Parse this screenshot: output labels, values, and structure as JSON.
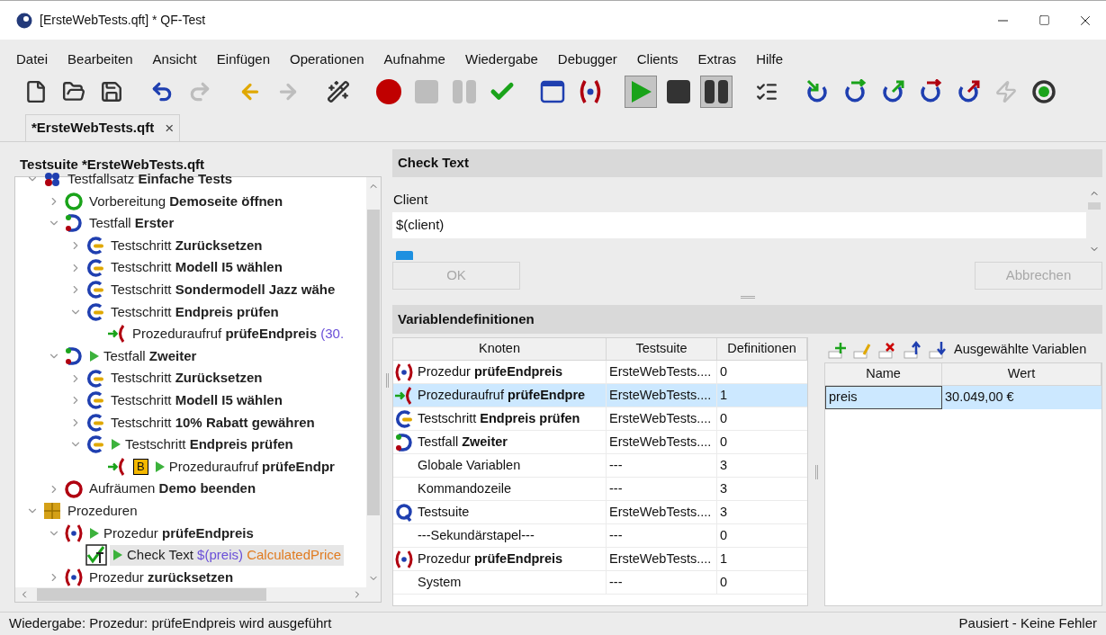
{
  "window": {
    "title": "[ErsteWebTests.qft] * QF-Test"
  },
  "menu": [
    "Datei",
    "Bearbeiten",
    "Ansicht",
    "Einfügen",
    "Operationen",
    "Aufnahme",
    "Wiedergabe",
    "Debugger",
    "Clients",
    "Extras",
    "Hilfe"
  ],
  "toolbar": [
    [
      {
        "kind": "new",
        "disabled": false
      },
      {
        "kind": "open",
        "disabled": false
      },
      {
        "kind": "save",
        "disabled": false
      }
    ],
    [
      {
        "kind": "undo",
        "disabled": false
      },
      {
        "kind": "redo",
        "disabled": true
      }
    ],
    [
      {
        "kind": "back",
        "disabled": false
      },
      {
        "kind": "forward",
        "disabled": true
      }
    ],
    [
      {
        "kind": "wizard",
        "disabled": false
      }
    ],
    [
      {
        "kind": "record",
        "disabled": false
      },
      {
        "kind": "stop",
        "disabled": true
      },
      {
        "kind": "pause",
        "disabled": true
      },
      {
        "kind": "check",
        "disabled": false
      }
    ],
    [
      {
        "kind": "window",
        "disabled": false
      },
      {
        "kind": "procedure",
        "disabled": false
      }
    ],
    [
      {
        "kind": "play",
        "disabled": false,
        "pressed": true
      },
      {
        "kind": "stop",
        "disabled": false,
        "pressed": false
      },
      {
        "kind": "pause",
        "disabled": false,
        "pressed": true
      }
    ],
    [
      {
        "kind": "results",
        "disabled": false
      }
    ],
    [
      {
        "kind": "step-in",
        "disabled": false
      },
      {
        "kind": "step-over",
        "disabled": false
      },
      {
        "kind": "step-out",
        "disabled": false
      },
      {
        "kind": "skip-over",
        "disabled": false
      },
      {
        "kind": "skip-out",
        "disabled": false
      },
      {
        "kind": "lightning",
        "disabled": true
      },
      {
        "kind": "target",
        "disabled": false
      }
    ]
  ],
  "document_tab": {
    "label": "*ErsteWebTests.qft",
    "close": "×",
    "selected": true
  },
  "tree_panel": {
    "title": "Testsuite *ErsteWebTests.qft",
    "tree": [
      {
        "kind": "testset",
        "label": "Testfallsatz",
        "name": "Einfache Tests",
        "running": false,
        "selected": false,
        "expanded": true,
        "children": [
          {
            "kind": "setup",
            "label": "Vorbereitung",
            "name": "Demoseite öffnen",
            "running": false,
            "selected": false,
            "expanded": false
          },
          {
            "kind": "testcase",
            "label": "Testfall",
            "name": "Erster",
            "running": false,
            "selected": false,
            "expanded": true,
            "children": [
              {
                "kind": "step",
                "label": "Testschritt",
                "name": "Zurücksetzen",
                "running": false,
                "selected": false,
                "expanded": false
              },
              {
                "kind": "step",
                "label": "Testschritt",
                "name": "Modell I5 wählen",
                "running": false,
                "selected": false,
                "expanded": false
              },
              {
                "kind": "step",
                "label": "Testschritt",
                "name": "Sondermodell Jazz wähe",
                "running": false,
                "selected": false,
                "expanded": false
              },
              {
                "kind": "step",
                "label": "Testschritt",
                "name": "Endpreis prüfen",
                "running": false,
                "selected": false,
                "expanded": true,
                "children": [
                  {
                    "kind": "call",
                    "label": "Prozeduraufruf",
                    "name": "prüfeEndpreis",
                    "extras": [
                      {
                        "kind": "variable",
                        "text": "(30."
                      }
                    ],
                    "running": false,
                    "selected": false
                  }
                ]
              }
            ]
          },
          {
            "kind": "testcase",
            "label": "Testfall",
            "name": "Zweiter",
            "running": true,
            "selected": false,
            "expanded": true,
            "children": [
              {
                "kind": "step",
                "label": "Testschritt",
                "name": "Zurücksetzen",
                "running": false,
                "selected": false,
                "expanded": false
              },
              {
                "kind": "step",
                "label": "Testschritt",
                "name": "Modell I5 wählen",
                "running": false,
                "selected": false,
                "expanded": false
              },
              {
                "kind": "step",
                "label": "Testschritt",
                "name": "10% Rabatt gewähren",
                "running": false,
                "selected": false,
                "expanded": false
              },
              {
                "kind": "step",
                "label": "Testschritt",
                "name": "Endpreis prüfen",
                "running": true,
                "selected": false,
                "expanded": true,
                "children": [
                  {
                    "kind": "call",
                    "label": "Prozeduraufruf",
                    "name": "prüfeEndpr",
                    "breakpoint": "B",
                    "running": true,
                    "selected": false
                  }
                ]
              }
            ]
          },
          {
            "kind": "cleanup",
            "label": "Aufräumen",
            "name": "Demo beenden",
            "running": false,
            "selected": false,
            "expanded": false
          }
        ]
      },
      {
        "kind": "package",
        "label": "Prozeduren",
        "running": false,
        "selected": false,
        "expanded": true,
        "children": [
          {
            "kind": "procedure",
            "label": "Prozedur",
            "name": "prüfeEndpreis",
            "running": true,
            "selected": false,
            "expanded": true,
            "children": [
              {
                "kind": "check",
                "label": "Check Text",
                "extras": [
                  {
                    "kind": "variable",
                    "text": "$(preis)"
                  },
                  {
                    "kind": "component",
                    "text": "CalculatedPrice"
                  }
                ],
                "running": true,
                "selected": true
              }
            ]
          },
          {
            "kind": "procedure",
            "label": "Prozedur",
            "name": "zurücksetzen",
            "running": false,
            "selected": false,
            "expanded": false
          }
        ]
      }
    ]
  },
  "editor": {
    "title": "Check Text",
    "client_label": "Client",
    "client_value": "$(client)",
    "buttons": [
      {
        "label": "OK",
        "disabled": true
      },
      {
        "label": "Abbrechen",
        "disabled": true
      }
    ]
  },
  "variables": {
    "title": "Variablendefinitionen",
    "columns": [
      "Knoten",
      "Testsuite",
      "Definitionen"
    ],
    "rows": [
      {
        "kind": "procedure",
        "label": "Prozedur",
        "name": "prüfeEndpreis",
        "suite": "ErsteWebTests....",
        "count": "0",
        "selected": false
      },
      {
        "kind": "call",
        "label": "Prozeduraufruf",
        "name": "prüfeEndpre",
        "suite": "ErsteWebTests....",
        "count": "1",
        "selected": true
      },
      {
        "kind": "step",
        "label": "Testschritt",
        "name": "Endpreis prüfen",
        "suite": "ErsteWebTests....",
        "count": "0",
        "selected": false
      },
      {
        "kind": "testcase",
        "label": "Testfall",
        "name": "Zweiter",
        "suite": "ErsteWebTests....",
        "count": "0",
        "selected": false
      },
      {
        "kind": "plain",
        "label": "Globale Variablen",
        "suite": "---",
        "count": "3",
        "selected": false
      },
      {
        "kind": "plain",
        "label": "Kommandozeile",
        "suite": "---",
        "count": "3",
        "selected": false
      },
      {
        "kind": "testsuite",
        "label": "Testsuite",
        "suite": "ErsteWebTests....",
        "count": "3",
        "selected": false
      },
      {
        "kind": "plain",
        "label": "---Sekundärstapel---",
        "suite": "---",
        "count": "0",
        "selected": false
      },
      {
        "kind": "procedure",
        "label": "Prozedur",
        "name": "prüfeEndpreis",
        "suite": "ErsteWebTests....",
        "count": "1",
        "selected": false
      },
      {
        "kind": "plain",
        "label": "System",
        "suite": "---",
        "count": "0",
        "selected": false
      }
    ],
    "tools": [
      {
        "kind": "add"
      },
      {
        "kind": "edit"
      },
      {
        "kind": "delete"
      },
      {
        "kind": "up"
      },
      {
        "kind": "down"
      }
    ],
    "selected_title": "Ausgewählte Variablen",
    "var_columns": [
      "Name",
      "Wert"
    ],
    "var_rows": [
      {
        "name": "preis",
        "value": "30.049,00 €",
        "selected": true
      }
    ]
  },
  "status_bar": {
    "left": "Wiedergabe: Prozedur: prüfeEndpreis wird ausgeführt",
    "right": "Pausiert - Keine Fehler"
  }
}
